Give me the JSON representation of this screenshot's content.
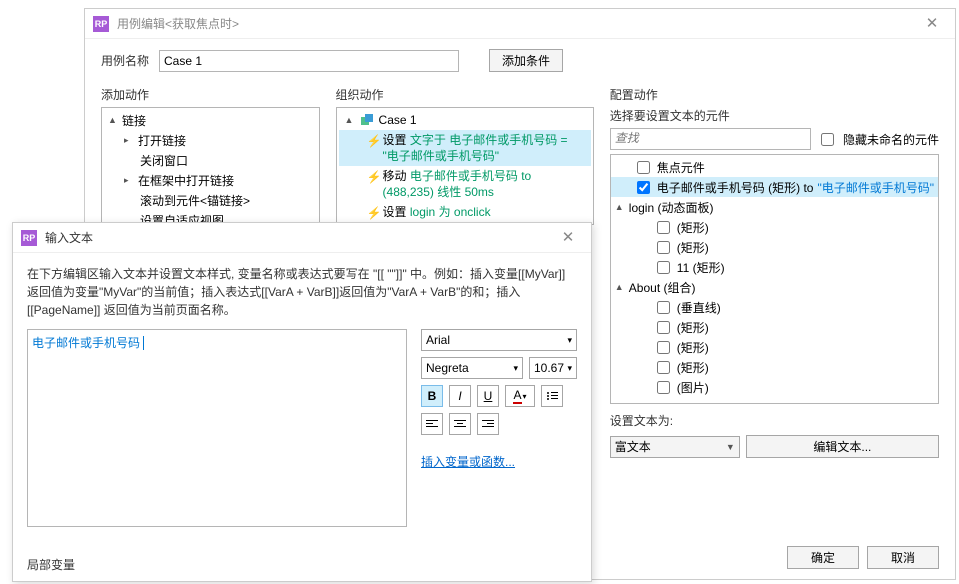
{
  "main_dialog": {
    "title": "用例编辑<获取焦点时>",
    "usecase_label": "用例名称",
    "usecase_value": "Case 1",
    "add_condition": "添加条件",
    "col_add": "添加动作",
    "col_org": "组织动作",
    "col_cfg": "配置动作",
    "add_tree": {
      "link_group": "链接",
      "open_link": "打开链接",
      "close_window": "关闭窗口",
      "open_in_frame": "在框架中打开链接",
      "scroll_to": "滚动到元件<锚链接>",
      "set_adaptive": "设置自适应视图"
    },
    "org": {
      "case_name": "Case 1",
      "a1_pre": "设置 ",
      "a1_link": "文字于 电子邮件或手机号码 = \"电子邮件或手机号码\"",
      "a2_pre": "移动 ",
      "a2_link": "电子邮件或手机号码 to (488,235) 线性 50ms",
      "a3_pre": "设置 ",
      "a3_link": "login 为 onclick"
    },
    "cfg": {
      "header": "选择要设置文本的元件",
      "search_placeholder": "查找",
      "hide_unnamed": "隐藏未命名的元件",
      "items": {
        "focus": "焦点元件",
        "target_a": "电子邮件或手机号码 (矩形) to ",
        "target_b": "\"电子邮件或手机号码\"",
        "login_group": "login (动态面板)",
        "rect": "(矩形)",
        "eleven_rect": "11 (矩形)",
        "about_group": "About (组合)",
        "vline": "(垂直线)",
        "image": "(图片)"
      },
      "set_text_label": "设置文本为:",
      "rich_text": "富文本",
      "edit_text": "编辑文本..."
    },
    "ok": "确定",
    "cancel": "取消"
  },
  "text_dialog": {
    "title": "输入文本",
    "desc": "在下方编辑区输入文本并设置文本样式, 变量名称或表达式要写在 \"[[ \"\"]]\" 中。例如：插入变量[[MyVar]]返回值为变量\"MyVar\"的当前值；插入表达式[[VarA + VarB]]返回值为\"VarA + VarB\"的和；插入 [[PageName]] 返回值为当前页面名称。",
    "content": "电子邮件或手机号码",
    "font": "Arial",
    "weight": "Negreta",
    "size": "10.67",
    "insert_var": "插入变量或函数...",
    "local_var": "局部变量"
  }
}
